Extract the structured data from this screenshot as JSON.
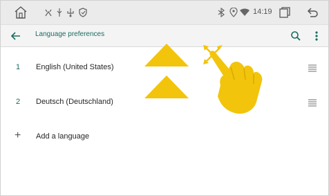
{
  "system_bar": {
    "time": "14:19",
    "icons": [
      "home-icon",
      "usb-debug-icon",
      "usb-icon",
      "usb-connection-icon",
      "shield-icon",
      "bluetooth-icon",
      "location-icon",
      "wifi-icon",
      "recent-apps-icon",
      "back-icon"
    ]
  },
  "app_bar": {
    "title": "Language preferences",
    "icons": [
      "back-arrow-icon",
      "search-icon",
      "more-vert-icon"
    ]
  },
  "languages": [
    {
      "number": "1",
      "name": "English (United States)"
    },
    {
      "number": "2",
      "name": "Deutsch (Deutschland)"
    }
  ],
  "add_language": {
    "label": "Add a language"
  },
  "colors": {
    "accent": "#1a6b60",
    "gesture": "#f2c40c",
    "system_bar_bg": "#ebebeb"
  }
}
